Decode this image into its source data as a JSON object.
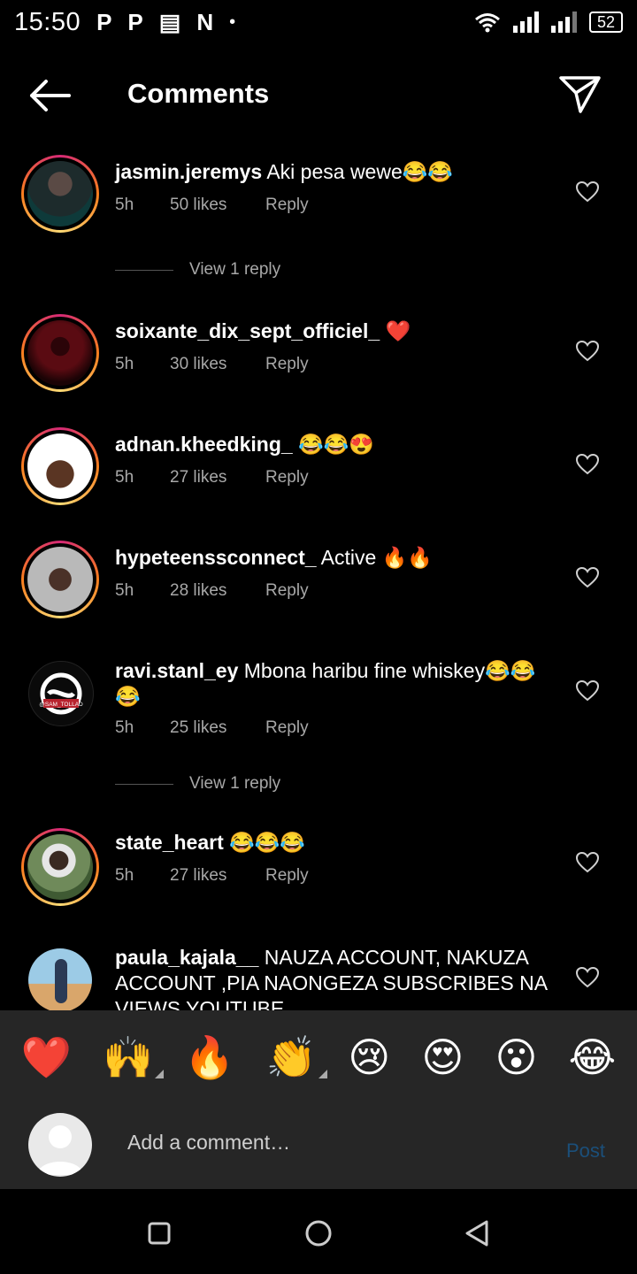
{
  "status_bar": {
    "time": "15:50",
    "icons": [
      "P",
      "P",
      "▤",
      "N"
    ],
    "dot": "•",
    "battery": "52"
  },
  "header": {
    "title": "Comments"
  },
  "comments": [
    {
      "user": "jasmin.jeremys",
      "text": " Aki pesa wewe😂😂",
      "time": "5h",
      "likes": "50 likes",
      "reply": "Reply",
      "view_replies": "View 1 reply"
    },
    {
      "user": "soixante_dix_sept_officiel_",
      "text": " ❤️",
      "time": "5h",
      "likes": "30 likes",
      "reply": "Reply"
    },
    {
      "user": "adnan.kheedking_",
      "text": " 😂😂😍",
      "time": "5h",
      "likes": "27 likes",
      "reply": "Reply"
    },
    {
      "user": "hypeteenssconnect_",
      "text": " Active 🔥🔥",
      "time": "5h",
      "likes": "28 likes",
      "reply": "Reply"
    },
    {
      "user": "ravi.stanl_ey",
      "text": " Mbona haribu fine whiskey😂😂😂",
      "time": "5h",
      "likes": "25 likes",
      "reply": "Reply",
      "view_replies": "View 1 reply",
      "avatar_text": "@SAM_TOLLAD"
    },
    {
      "user": "state_heart",
      "text": " 😂😂😂",
      "time": "5h",
      "likes": "27 likes",
      "reply": "Reply"
    },
    {
      "user": "paula_kajala__",
      "text": " NAUZA ACCOUNT, NAKUZA ACCOUNT ,PIA NAONGEZA SUBSCRIBES NA VIEWS YOUTUBE"
    }
  ],
  "reactions": [
    "❤️",
    "🙌",
    "🔥",
    "👏",
    "😢",
    "😍",
    "😮",
    "😂"
  ],
  "compose": {
    "placeholder": "Add a comment…",
    "post_label": "Post"
  },
  "colors": {
    "background": "#000000",
    "panel": "#262626",
    "meta_text": "#a8a8a8",
    "post_disabled": "#1b4f7a",
    "ring_gradient": [
      "#d62976",
      "#fa7e1e",
      "#feda75"
    ]
  }
}
